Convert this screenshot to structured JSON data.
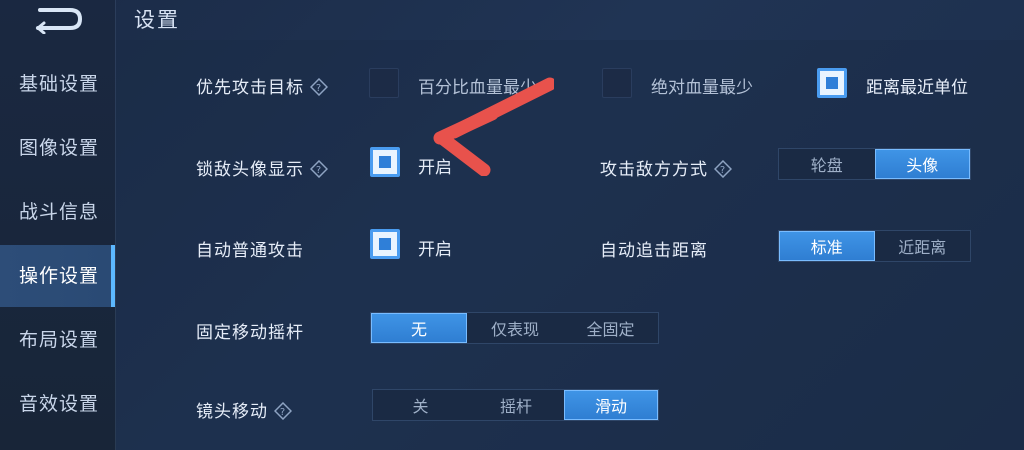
{
  "page_title": "设置",
  "sidebar": {
    "items": [
      {
        "label": "基础设置",
        "active": false
      },
      {
        "label": "图像设置",
        "active": false
      },
      {
        "label": "战斗信息",
        "active": false
      },
      {
        "label": "操作设置",
        "active": true
      },
      {
        "label": "布局设置",
        "active": false
      },
      {
        "label": "音效设置",
        "active": false
      }
    ]
  },
  "settings": {
    "priority_target": {
      "label": "优先攻击目标",
      "options": [
        {
          "label": "百分比血量最少",
          "checked": false
        },
        {
          "label": "绝对血量最少",
          "checked": false
        },
        {
          "label": "距离最近单位",
          "checked": true
        }
      ]
    },
    "lock_enemy_avatar": {
      "label": "锁敌头像显示",
      "option_label": "开启",
      "checked": true
    },
    "attack_enemy_mode": {
      "label": "攻击敌方方式",
      "options": [
        "轮盘",
        "头像"
      ],
      "selected": "头像"
    },
    "auto_attack": {
      "label": "自动普通攻击",
      "option_label": "开启",
      "checked": true
    },
    "auto_chase_distance": {
      "label": "自动追击距离",
      "options": [
        "标准",
        "近距离"
      ],
      "selected": "标准"
    },
    "fixed_joystick": {
      "label": "固定移动摇杆",
      "options": [
        "无",
        "仅表现",
        "全固定"
      ],
      "selected": "无"
    },
    "camera_move": {
      "label": "镜头移动",
      "options": [
        "关",
        "摇杆",
        "滑动"
      ],
      "selected": "滑动"
    }
  },
  "colors": {
    "accent": "#3f94e6",
    "annotation_arrow": "#e8524c"
  }
}
